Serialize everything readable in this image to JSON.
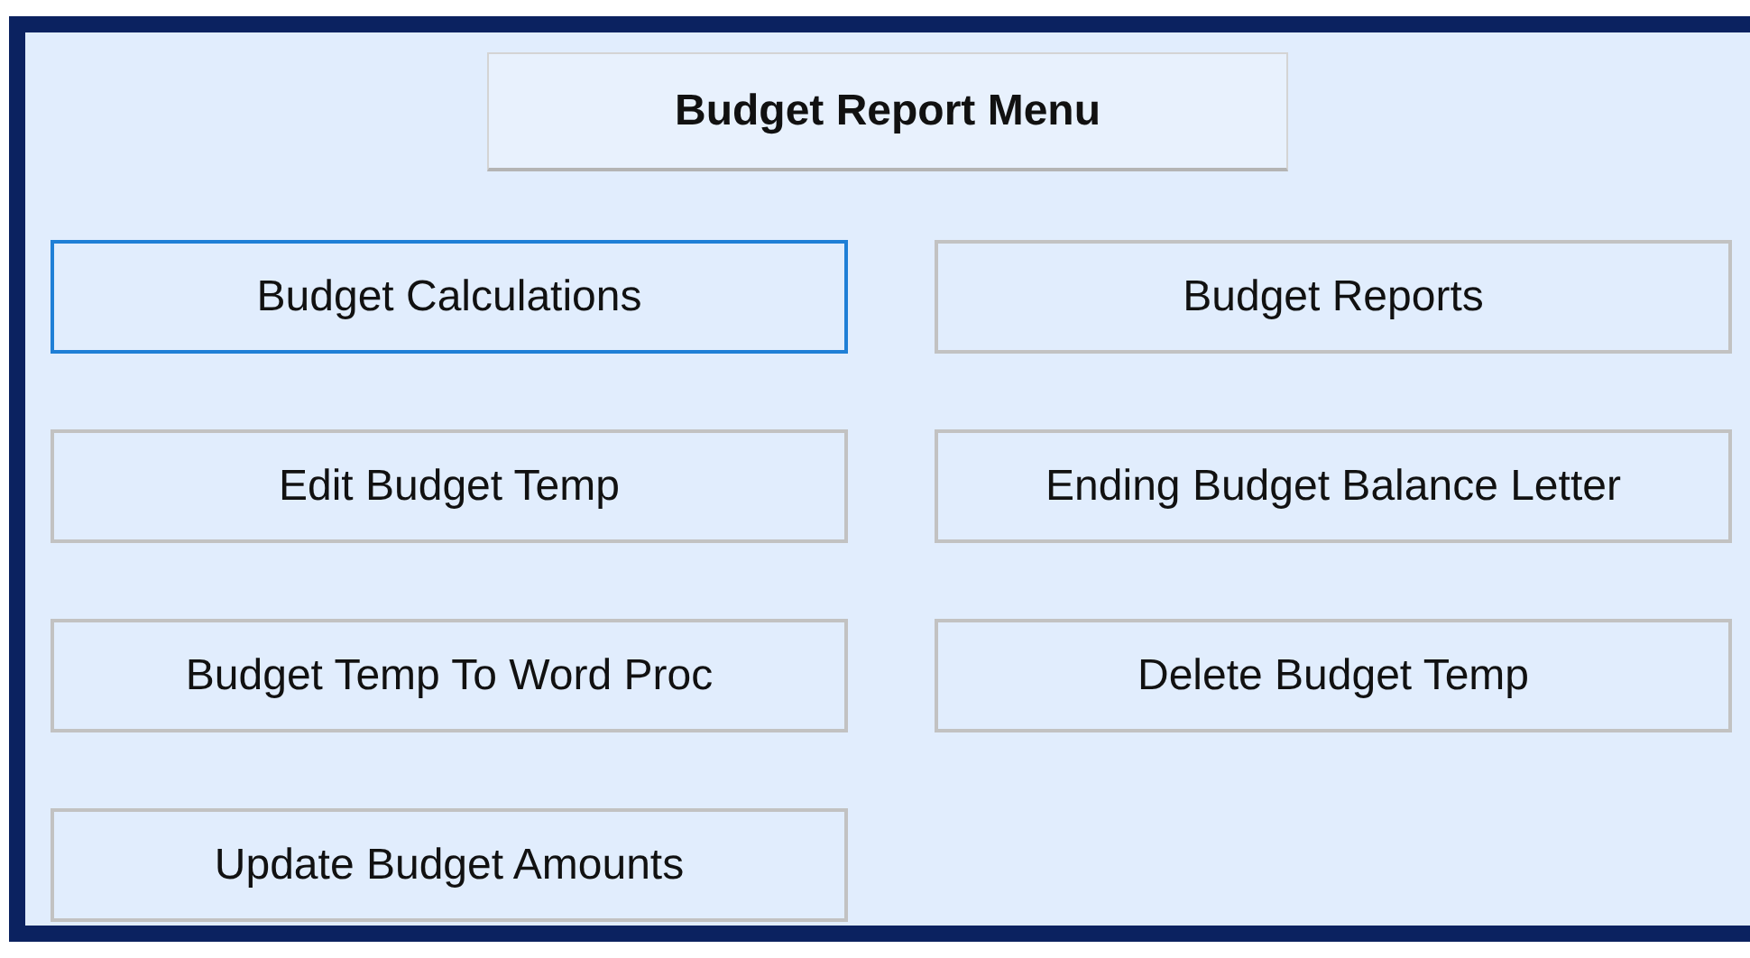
{
  "title": "Budget Report Menu",
  "buttons": [
    {
      "label": "Budget Calculations",
      "focused": true
    },
    {
      "label": "Budget Reports",
      "focused": false
    },
    {
      "label": "Edit Budget Temp",
      "focused": false
    },
    {
      "label": "Ending Budget Balance Letter",
      "focused": false
    },
    {
      "label": "Budget Temp To Word Proc",
      "focused": false
    },
    {
      "label": "Delete Budget Temp",
      "focused": false
    },
    {
      "label": "Update Budget Amounts",
      "focused": false
    }
  ]
}
